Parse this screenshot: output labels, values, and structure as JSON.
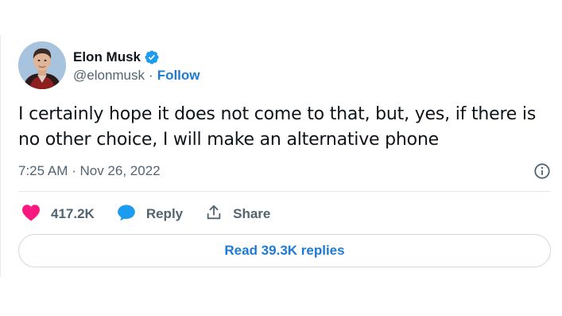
{
  "author": {
    "display_name": "Elon Musk",
    "handle": "@elonmusk",
    "separator": "·",
    "follow_label": "Follow",
    "verified": true
  },
  "tweet": {
    "text": "I certainly hope it does not come to that, but, yes, if there is no other choice, I will make an alternative phone",
    "timestamp": "7:25 AM · Nov 26, 2022"
  },
  "actions": {
    "likes": "417.2K",
    "reply_label": "Reply",
    "share_label": "Share"
  },
  "read_replies_label": "Read 39.3K replies",
  "colors": {
    "text": "#0f1419",
    "secondary": "#536471",
    "link": "#1d7ad6",
    "like": "#f91880",
    "verified": "#1d9bf0",
    "divider": "#e1e8ed"
  },
  "icons": {
    "verified": "verified-badge-icon",
    "info": "info-icon",
    "like": "heart-icon",
    "reply": "speech-bubble-icon",
    "share": "share-upload-icon"
  }
}
